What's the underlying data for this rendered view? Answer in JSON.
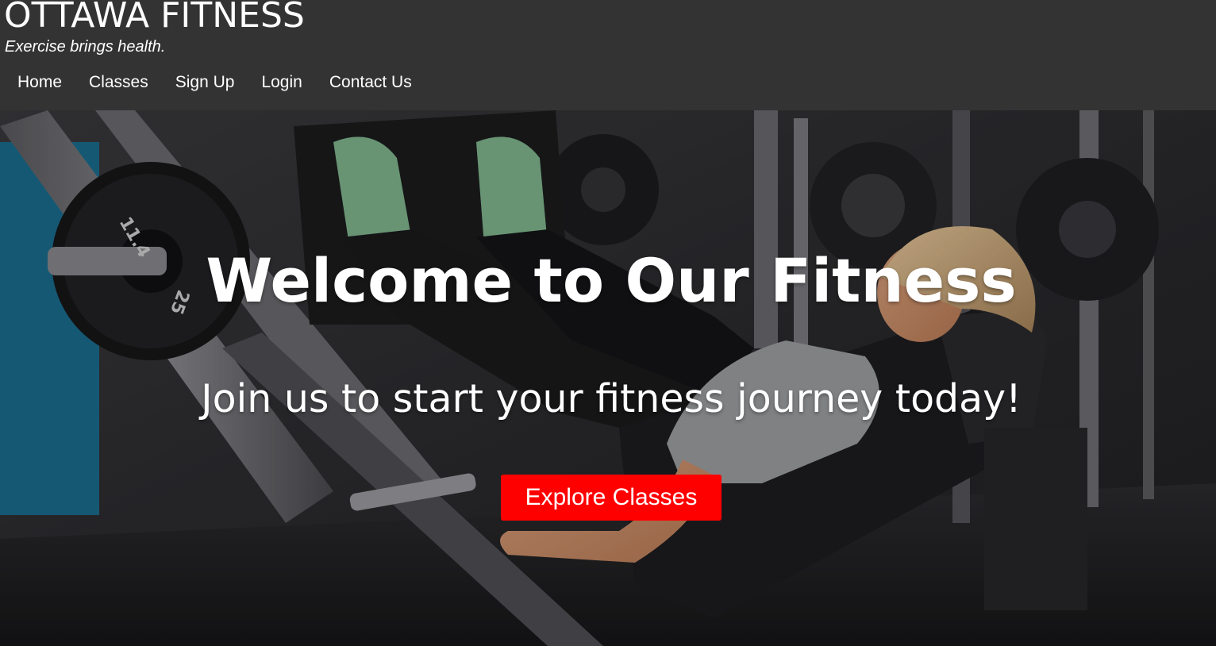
{
  "header": {
    "site_title": "OTTAWA FITNESS",
    "tagline": "Exercise brings health."
  },
  "nav": {
    "items": [
      "Home",
      "Classes",
      "Sign Up",
      "Login",
      "Contact Us"
    ]
  },
  "hero": {
    "title": "Welcome to Our Fitness",
    "subtitle": "Join us to start your fitness journey today!",
    "cta_label": "Explore Classes",
    "image": "gym-leg-press-photo"
  },
  "colors": {
    "header_bg": "#333333",
    "cta_bg": "#ff0000",
    "text": "#ffffff"
  }
}
